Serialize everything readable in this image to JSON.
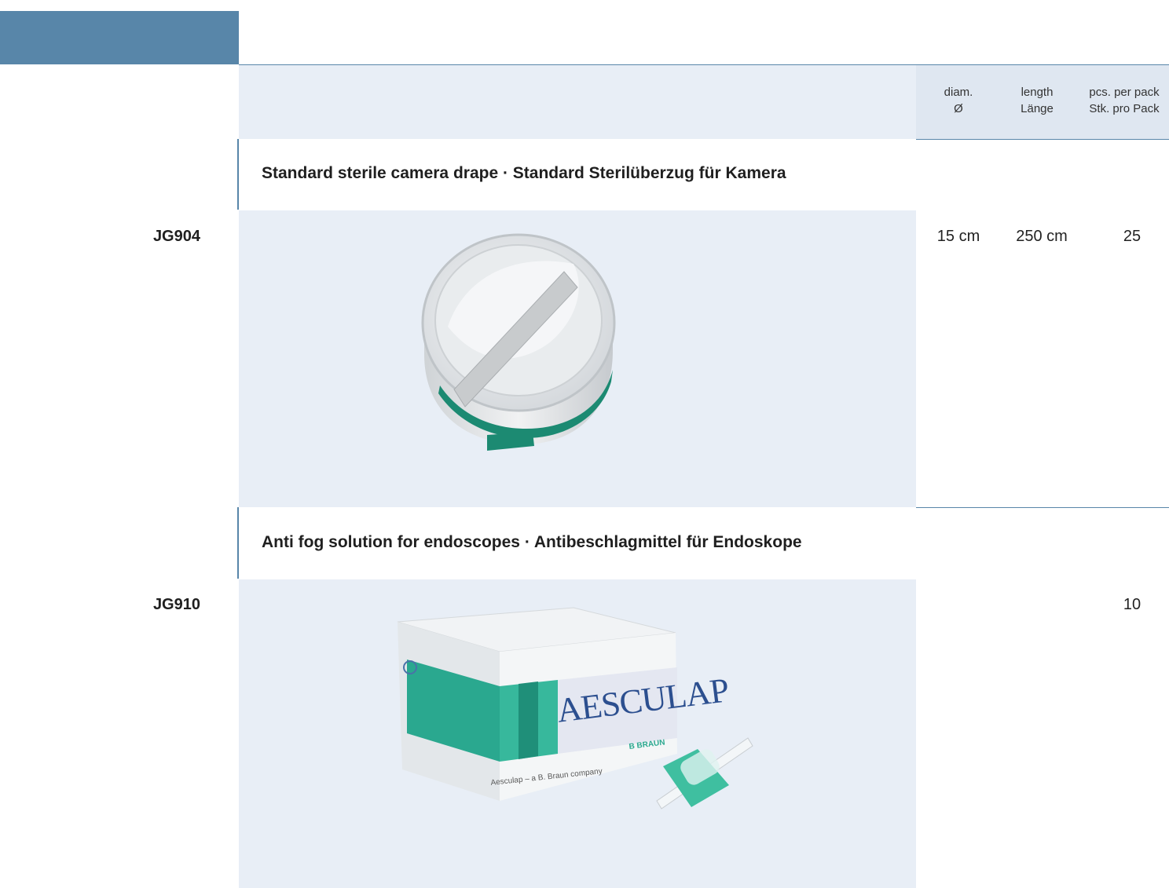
{
  "columns": {
    "diam": [
      "diam.",
      "Ø"
    ],
    "length": [
      "length",
      "Länge"
    ],
    "pack": [
      "pcs. per pack",
      "Stk. pro Pack"
    ]
  },
  "sections": [
    {
      "title": "Standard sterile camera drape · Standard Sterilüberzug für Kamera",
      "code": "JG904",
      "diam": "15 cm",
      "length": "250 cm",
      "pack": "25"
    },
    {
      "title": "Anti fog solution for endoscopes · Antibeschlagmittel für Endoskope",
      "code": "JG910",
      "diam": "",
      "length": "",
      "pack": "10"
    }
  ],
  "product_box": {
    "brand": "AESCULAP",
    "tagline": "Aesculap – a B. Braun company",
    "maker": "B BRAUN"
  },
  "colors": {
    "accent": "#5886a9",
    "band": "#e8eef6",
    "teal": "#2aa88f"
  }
}
